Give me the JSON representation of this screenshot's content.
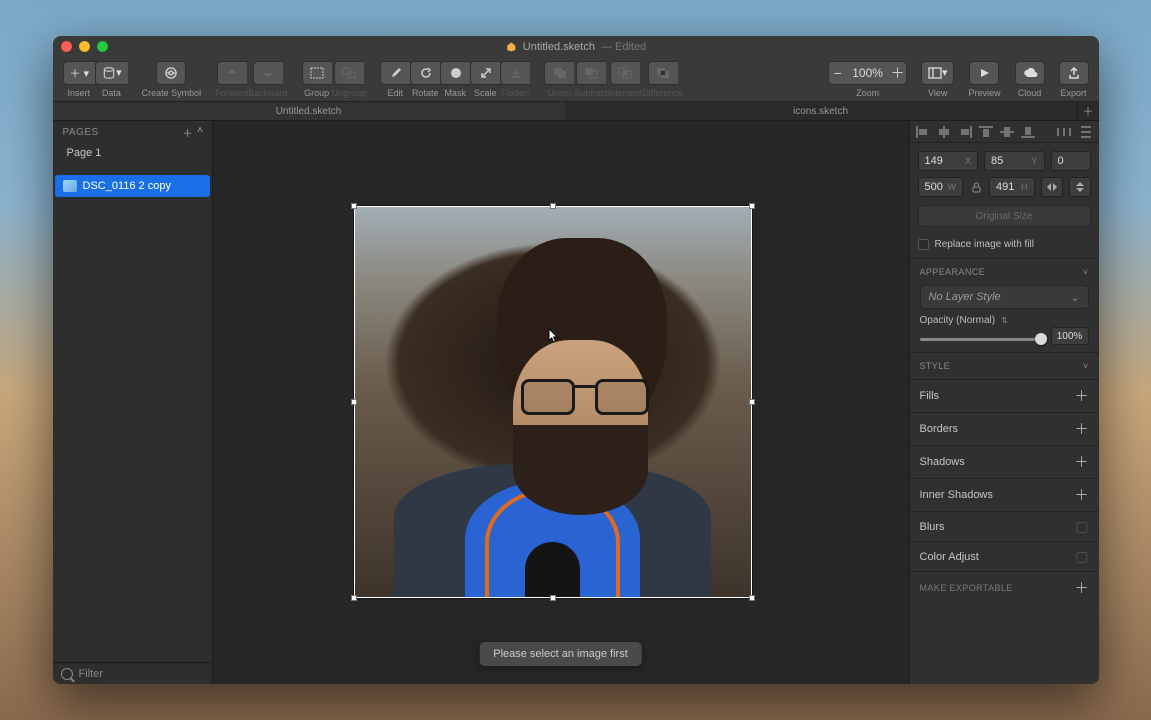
{
  "window": {
    "title": "Untitled.sketch",
    "title_suffix": " — Edited"
  },
  "toolbar": {
    "insert": "Insert",
    "data": "Data",
    "create_symbol": "Create Symbol",
    "forward": "Forward",
    "backward": "Backward",
    "group": "Group",
    "ungroup": "Ungroup",
    "edit": "Edit",
    "rotate": "Rotate",
    "mask": "Mask",
    "scale": "Scale",
    "flatten": "Flatten",
    "union": "Union",
    "subtract": "Subtract",
    "intersect": "Intersect",
    "difference": "Difference",
    "zoom_label": "Zoom",
    "zoom_value": "100%",
    "view": "View",
    "preview": "Preview",
    "cloud": "Cloud",
    "export": "Export"
  },
  "tabs": {
    "tab1": "Untitled.sketch",
    "tab2": "icons.sketch"
  },
  "left": {
    "pages_label": "PAGES",
    "page1": "Page 1",
    "layer_name": "DSC_0116 2 copy",
    "filter_label": "Filter"
  },
  "canvas": {
    "toast": "Please select an image first"
  },
  "inspector": {
    "x": "149",
    "x_label": "X",
    "y": "85",
    "y_label": "Y",
    "rot": "0",
    "w": "500",
    "w_label": "W",
    "h": "491",
    "h_label": "H",
    "original_size": "Original Size",
    "replace_fill": "Replace image with fill",
    "appearance": "APPEARANCE",
    "layer_style": "No Layer Style",
    "opacity_label": "Opacity (Normal)",
    "opacity_value": "100%",
    "style": "STYLE",
    "fills": "Fills",
    "borders": "Borders",
    "shadows": "Shadows",
    "inner_shadows": "Inner Shadows",
    "blurs": "Blurs",
    "color_adjust": "Color Adjust",
    "make_exportable": "MAKE EXPORTABLE"
  }
}
